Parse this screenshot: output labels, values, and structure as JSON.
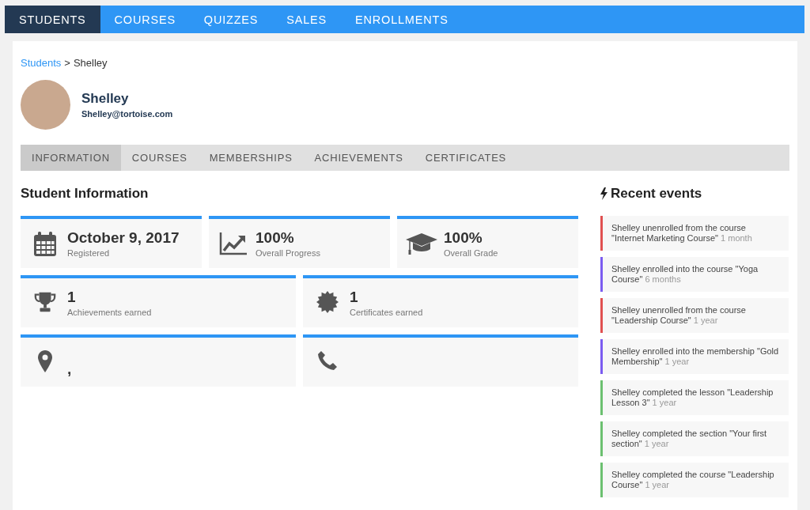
{
  "top_nav": [
    {
      "label": "STUDENTS",
      "selected": true
    },
    {
      "label": "COURSES",
      "selected": false
    },
    {
      "label": "QUIZZES",
      "selected": false
    },
    {
      "label": "SALES",
      "selected": false
    },
    {
      "label": "ENROLLMENTS",
      "selected": false
    }
  ],
  "breadcrumb": {
    "link": "Students",
    "separator": ">",
    "current": "Shelley"
  },
  "profile": {
    "name": "Shelley",
    "email": "Shelley@tortoise.com"
  },
  "tabs": [
    {
      "label": "INFORMATION",
      "selected": true
    },
    {
      "label": "COURSES",
      "selected": false
    },
    {
      "label": "MEMBERSHIPS",
      "selected": false
    },
    {
      "label": "ACHIEVEMENTS",
      "selected": false
    },
    {
      "label": "CERTIFICATES",
      "selected": false
    }
  ],
  "info_title": "Student Information",
  "info_rows": [
    [
      {
        "kind": "date",
        "value": "October 9, 2017",
        "label": "Registered"
      },
      {
        "kind": "progress",
        "value": "100%",
        "label": "Overall Progress"
      },
      {
        "kind": "grade",
        "value": "100%",
        "label": "Overall Grade"
      }
    ],
    [
      {
        "kind": "achievements",
        "value": "1",
        "label": "Achievements earned"
      },
      {
        "kind": "certificates",
        "value": "1",
        "label": "Certificates earned"
      }
    ],
    [
      {
        "kind": "location",
        "value": ","
      },
      {
        "kind": "phone"
      }
    ]
  ],
  "events_title": "Recent events",
  "events": [
    {
      "text": "Shelley unenrolled from the course \"Internet Marketing Course\"",
      "time": "1 month",
      "color": "#e05050"
    },
    {
      "text": "Shelley enrolled into the course \"Yoga Course\"",
      "time": "6 months",
      "color": "#7b5cf0"
    },
    {
      "text": "Shelley unenrolled from the course \"Leadership Course\"",
      "time": "1 year",
      "color": "#e05050"
    },
    {
      "text": "Shelley enrolled into the membership \"Gold Membership\"",
      "time": "1 year",
      "color": "#7b5cf0"
    },
    {
      "text": "Shelley completed the lesson \"Leadership Lesson 3\"",
      "time": "1 year",
      "color": "#6cc070"
    },
    {
      "text": "Shelley completed the section \"Your first section\"",
      "time": "1 year",
      "color": "#6cc070"
    },
    {
      "text": "Shelley completed the course \"Leadership Course\"",
      "time": "1 year",
      "color": "#6cc070"
    }
  ]
}
